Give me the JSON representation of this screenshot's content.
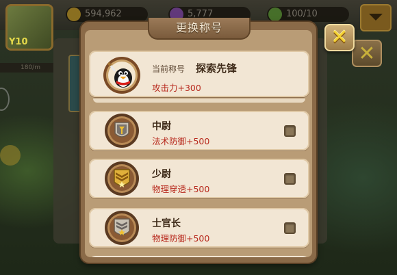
{
  "background": {
    "level": "Y10",
    "resources": [
      {
        "icon": "gold-coin-icon",
        "value": "594,962"
      },
      {
        "icon": "gem-icon",
        "value": "5,777"
      },
      {
        "icon": "leaf-icon",
        "value": "100/10"
      }
    ],
    "strip_text": "180/m"
  },
  "dialog": {
    "title": "更换称号",
    "current": {
      "label": "当前称号",
      "name": "探索先锋",
      "bonus": "攻击力+300",
      "icon": "penguin-avatar-icon"
    },
    "titles": [
      {
        "name": "中尉",
        "bonus": "法术防御+500",
        "icon": "rank-badge-lieutenant-icon",
        "checked": false
      },
      {
        "name": "少尉",
        "bonus": "物理穿透+500",
        "icon": "rank-badge-second-lieutenant-icon",
        "checked": false
      },
      {
        "name": "士官长",
        "bonus": "物理防御+500",
        "icon": "rank-badge-master-sergeant-icon",
        "checked": false
      }
    ],
    "close_icon": "close-x-icon"
  },
  "colors": {
    "bonus_text": "#b82a1e",
    "row_bg": "#f2e6d4",
    "dialog_frame": "#8a6a48",
    "close_x": "#f4d234"
  }
}
